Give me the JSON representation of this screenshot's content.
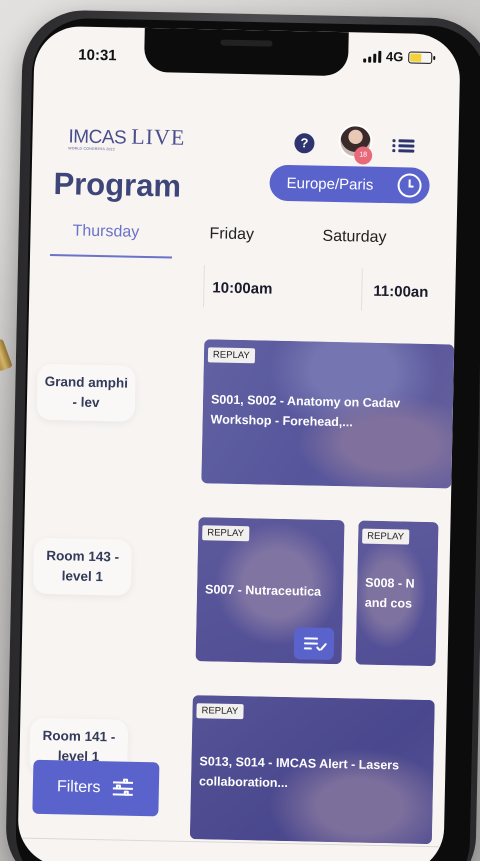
{
  "status": {
    "time": "10:31",
    "network": "4G"
  },
  "header": {
    "logo_main": "IMCAS",
    "logo_live": "LIVE",
    "logo_sub": "WORLD CONGRESS 2022",
    "avatar_badge": "18"
  },
  "page": {
    "title": "Program"
  },
  "timezone": {
    "label": "Europe/Paris"
  },
  "tabs": [
    {
      "label": "Thursday",
      "selected": true
    },
    {
      "label": "Friday",
      "selected": false
    },
    {
      "label": "Saturday",
      "selected": false
    }
  ],
  "times": [
    "10:00am",
    "11:00an"
  ],
  "rooms": [
    {
      "name": "Grand amphi - lev"
    },
    {
      "name": "Room 143 - level 1"
    },
    {
      "name": "Room 141 - level 1"
    }
  ],
  "sessions": [
    {
      "badge": "REPLAY",
      "line1": "S001, S002 - Anatomy on Cadav",
      "line2": "Workshop - Forehead,..."
    },
    {
      "badge": "REPLAY",
      "line1": "S007 - Nutraceutica",
      "line2": ""
    },
    {
      "badge": "REPLAY",
      "line1": "S008 - N",
      "line2": "and cos"
    },
    {
      "badge": "REPLAY",
      "line1": "S013, S014 - IMCAS Alert - Lasers",
      "line2": "collaboration..."
    }
  ],
  "filters": {
    "label": "Filters"
  },
  "colors": {
    "accent": "#5a63cc",
    "title": "#3e4578",
    "tab_active": "#6a73c9",
    "card_overlay": "#484696"
  }
}
